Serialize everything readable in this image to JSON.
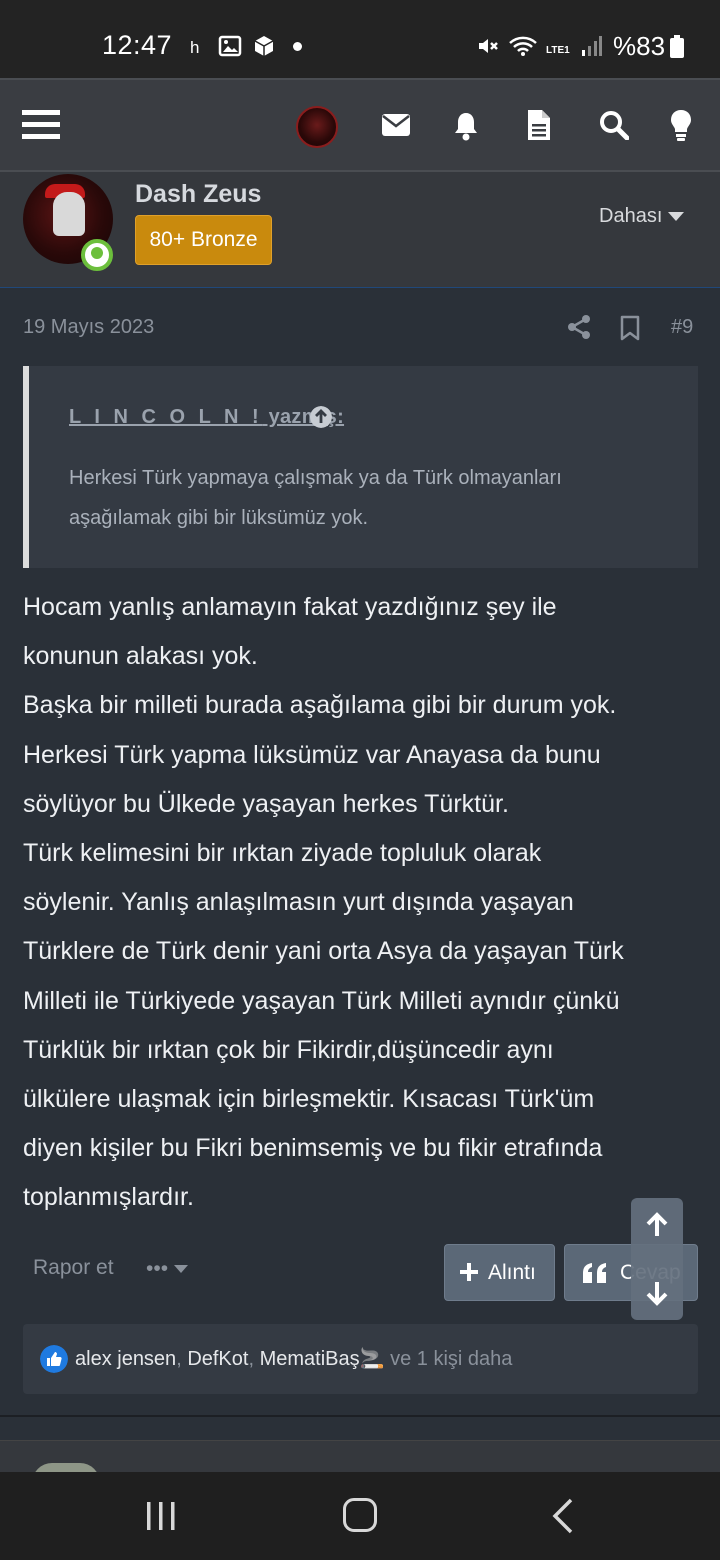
{
  "status_bar": {
    "time": "12:47",
    "indicator_h": "h",
    "network": "LTE1",
    "battery": "%83"
  },
  "app_header": {
    "icons": [
      "menu-icon",
      "avatar",
      "mail-icon",
      "bell-icon",
      "document-icon",
      "search-icon",
      "lightbulb-icon"
    ]
  },
  "profile": {
    "username": "Dash Zeus",
    "rank": "80+ Bronze",
    "more_label": "Dahası"
  },
  "post": {
    "date": "19 Mayıs 2023",
    "number": "#9",
    "quote": {
      "author": "L I N C O L N !",
      "author_suffix": " yazmış:",
      "text": "Herkesi Türk yapmaya çalışmak ya da Türk olmayanları aşağılamak gibi bir lüksümüz yok."
    },
    "lines": [
      "Hocam yanlış anlamayın fakat yazdığınız şey ile",
      "konunun alakası yok.",
      "Başka bir milleti burada aşağılama gibi bir durum yok.",
      "Herkesi Türk yapma lüksümüz var Anayasa da bunu",
      "söylüyor bu Ülkede yaşayan herkes Türktür.",
      "Türk kelimesini bir ırktan ziyade topluluk olarak",
      "söylenir. Yanlış anlaşılmasın yurt dışında yaşayan",
      "Türklere de Türk denir yani orta Asya da yaşayan Türk",
      "Milleti ile Türkiyede yaşayan Türk Milleti aynıdır çünkü",
      "Türklük bir ırktan çok bir Fikirdir,düşüncedir aynı",
      "ülkülere ulaşmak için birleşmektir. Kısacası Türk'üm",
      "diyen kişiler bu Fikri benimsemiş ve bu fikir etrafında",
      "toplanmışlardır."
    ],
    "actions": {
      "report": "Rapor et",
      "dots": "•••",
      "quote_button": "Alıntı",
      "reply_button": "Cevap"
    },
    "reactions": {
      "users": [
        "alex jensen",
        "DefKot",
        "MematiBaş🚬"
      ],
      "separator": ",",
      "more": " ve 1 kişi daha"
    }
  },
  "colors": {
    "background": "#2a3038",
    "rank_badge": "#c98a0d",
    "online": "#6cbf3c",
    "like": "#1f7ae0"
  }
}
